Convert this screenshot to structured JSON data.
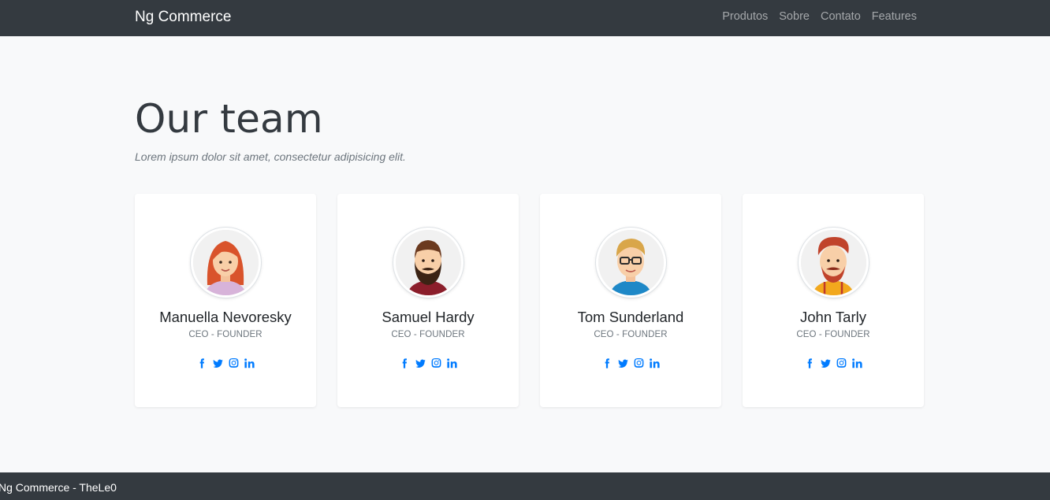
{
  "navbar": {
    "brand": "Ng Commerce",
    "links": [
      "Produtos",
      "Sobre",
      "Contato",
      "Features"
    ]
  },
  "section": {
    "title": "Our team",
    "subtitle": "Lorem ipsum dolor sit amet, consectetur adipisicing elit."
  },
  "team": [
    {
      "name": "Manuella Nevoresky",
      "role": "CEO - FOUNDER",
      "avatar": "female-avatar-red-hair"
    },
    {
      "name": "Samuel Hardy",
      "role": "CEO - FOUNDER",
      "avatar": "male-avatar-beard"
    },
    {
      "name": "Tom Sunderland",
      "role": "CEO - FOUNDER",
      "avatar": "male-avatar-glasses"
    },
    {
      "name": "John Tarly",
      "role": "CEO - FOUNDER",
      "avatar": "male-avatar-mustache"
    }
  ],
  "social_icons": [
    "facebook-icon",
    "twitter-icon",
    "instagram-icon",
    "linkedin-icon"
  ],
  "footer": {
    "text": "Ng Commerce - TheLe0"
  },
  "colors": {
    "navbar": "#343a40",
    "background": "#f8f9fa",
    "link": "#007bff",
    "card": "#ffffff"
  }
}
